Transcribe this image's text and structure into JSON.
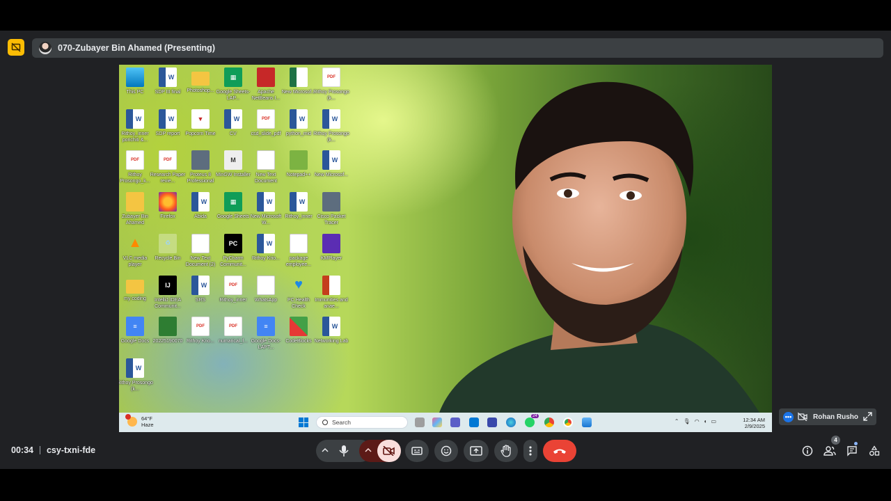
{
  "header": {
    "presenter_label": "070-Zubayer Bin Ahamed (Presenting)"
  },
  "desktop": {
    "icons": [
      {
        "label": "This PC",
        "type": "pc"
      },
      {
        "label": "SDP III final",
        "type": "word"
      },
      {
        "label": "Photoshop...",
        "type": "folder"
      },
      {
        "label": "Google Sheets-LAP...",
        "type": "sheets"
      },
      {
        "label": "Apache NetBeans I...",
        "type": "netbeans"
      },
      {
        "label": "New Microsof...",
        "type": "excel"
      },
      {
        "label": "Rithoy Prosongo (k...",
        "type": "pdf"
      },
      {
        "label": "Rithoy_inner porichiti &...",
        "type": "word"
      },
      {
        "label": "SDP report",
        "type": "word"
      },
      {
        "label": "Popcorn Time",
        "type": "popcorn"
      },
      {
        "label": "CV",
        "type": "word"
      },
      {
        "label": "csd_slide_pdf",
        "type": "pdf"
      },
      {
        "label": "python_mid",
        "type": "word"
      },
      {
        "label": "Rithoy Prosongo (k...",
        "type": "word"
      },
      {
        "label": "Rithoy Prosongo_k...",
        "type": "pdf"
      },
      {
        "label": "Research Paper revie...",
        "type": "pdf"
      },
      {
        "label": "Proteus 8 Professional",
        "type": "proteus"
      },
      {
        "label": "MinGW Installer",
        "type": "mingw"
      },
      {
        "label": "New Text Document",
        "type": "blank"
      },
      {
        "label": "Notepad++",
        "type": "notepad"
      },
      {
        "label": "New Microsof...",
        "type": "word"
      },
      {
        "label": "Zubayer Bin Ahamed",
        "type": "user"
      },
      {
        "label": "Firefox",
        "type": "firefox"
      },
      {
        "label": "Abida",
        "type": "word"
      },
      {
        "label": "Google Sheets",
        "type": "sheets"
      },
      {
        "label": "New Microsoft W...",
        "type": "word"
      },
      {
        "label": "Rithoy_inner",
        "type": "word"
      },
      {
        "label": "Cisco Packet Tracer",
        "type": "cisco"
      },
      {
        "label": "VLC media player",
        "type": "vlc"
      },
      {
        "label": "Recycle Bin",
        "type": "recycle"
      },
      {
        "label": "New Text Document (2)",
        "type": "blank"
      },
      {
        "label": "PyCharm Communit...",
        "type": "pycharm"
      },
      {
        "label": "Rithoy Krio...",
        "type": "word"
      },
      {
        "label": "package employee...",
        "type": "blank"
      },
      {
        "label": "KMPlayer",
        "type": "kms"
      },
      {
        "label": "my coding",
        "type": "folder"
      },
      {
        "label": "IntelliJ IDEA Communit...",
        "type": "intellij"
      },
      {
        "label": "SRS",
        "type": "word"
      },
      {
        "label": "Rithoy_inner",
        "type": "pdf"
      },
      {
        "label": "WhatsApp",
        "type": "blank"
      },
      {
        "label": "PC Health Check",
        "type": "health"
      },
      {
        "label": "Immunities and anae...",
        "type": "ppt"
      },
      {
        "label": "Google Docs",
        "type": "docs"
      },
      {
        "label": "20225190070",
        "type": "green"
      },
      {
        "label": "Rithoy Krio...",
        "type": "pdf"
      },
      {
        "label": "numarical_f...",
        "type": "pdf"
      },
      {
        "label": "Google Docs-LAPT...",
        "type": "docs"
      },
      {
        "label": "CodeBlocks",
        "type": "code"
      },
      {
        "label": "Networking Lab",
        "type": "word"
      },
      {
        "label": "Rithoy Prosongo (k...",
        "type": "word"
      }
    ]
  },
  "taskbar": {
    "temperature": "64°F",
    "weather": "Haze",
    "search_placeholder": "Search",
    "time": "12:34 AM",
    "date": "2/9/2025",
    "whatsapp_badge": "24"
  },
  "participant_tile": {
    "name": "Rohan Rusho"
  },
  "meeting": {
    "elapsed": "00:34",
    "code": "csy-txni-fde",
    "people_count": "4"
  },
  "colors": {
    "end_call": "#ea4335",
    "camera_off_bg": "#f9dedc",
    "presenting_badge": "#fbbc04"
  }
}
